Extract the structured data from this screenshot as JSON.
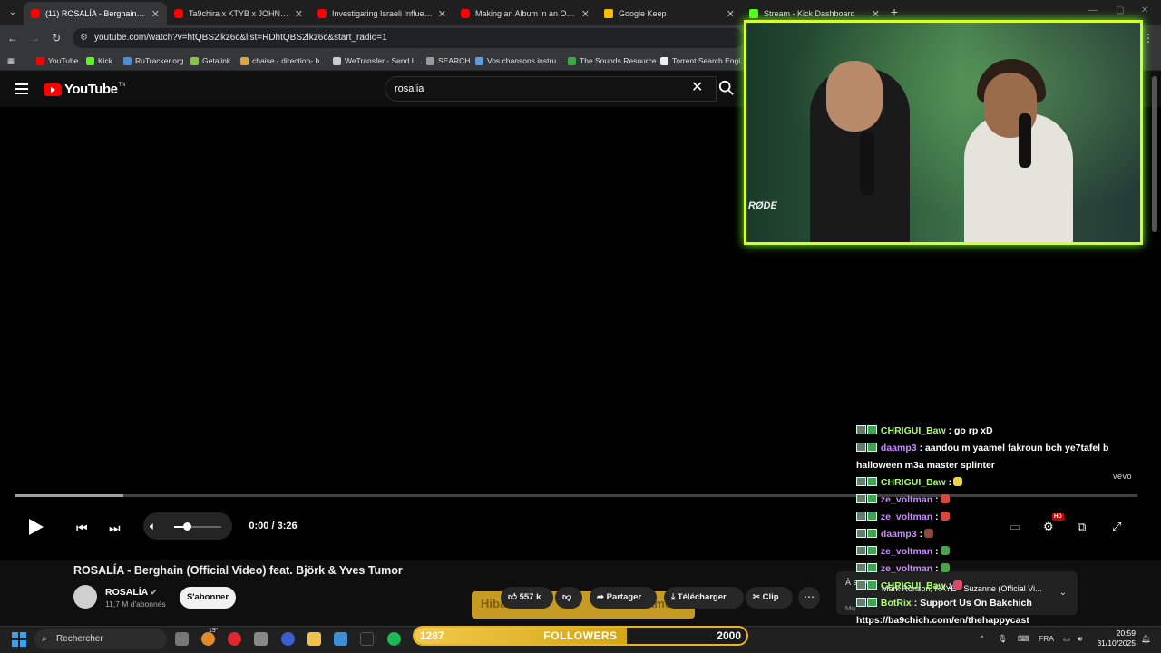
{
  "browser": {
    "tabs": [
      {
        "title": "(11) ROSALÍA - Berghain (Official",
        "icon": "youtube-icon",
        "active": true
      },
      {
        "title": "Ta9chira x KTYB x JOHNSIX - E",
        "icon": "youtube-icon",
        "active": false
      },
      {
        "title": "Investigating Israeli Influence o",
        "icon": "youtube-icon",
        "active": false
      },
      {
        "title": "Making an Album in an OPEN",
        "icon": "youtube-icon",
        "active": false
      },
      {
        "title": "Google Keep",
        "icon": "keep-icon",
        "active": false
      },
      {
        "title": "Stream - Kick Dashboard",
        "icon": "kick-icon",
        "active": false
      }
    ],
    "url": "youtube.com/watch?v=htQBS2lkz6c&list=RDhtQBS2lkz6c&start_radio=1",
    "bookmarks": [
      {
        "label": "YouTube",
        "color": "#ff0000"
      },
      {
        "label": "Kick",
        "color": "#53fc18"
      },
      {
        "label": "RuTracker.org",
        "color": "#4a90d9"
      },
      {
        "label": "Getalink",
        "color": "#8bc34a"
      },
      {
        "label": "chaise - direction- b...",
        "color": "#e2a73a"
      },
      {
        "label": "WeTransfer - Send L...",
        "color": "#cccccc"
      },
      {
        "label": "SEARCH",
        "color": "#999999"
      },
      {
        "label": "Vos chansons instru...",
        "color": "#5aa0e0"
      },
      {
        "label": "The Sounds Resource",
        "color": "#39a845"
      },
      {
        "label": "Torrent Search Engi...",
        "color": "#eeeeee"
      }
    ]
  },
  "youtube": {
    "logo_text": "YouTube",
    "logo_sup": "TN",
    "search_value": "rosalia",
    "player": {
      "time": "0:00 / 3:26",
      "vevo": "vevo",
      "hd_badge": "HD",
      "loaded_fraction": 0.097,
      "volume_fraction": 0.27
    },
    "video_title": "ROSALÍA - Berghain (Official Video) feat. Björk & Yves Tumor",
    "channel": {
      "name": "ROSALÍA",
      "subscribers": "11,7 M d'abonnés",
      "subscribe_label": "S'abonner"
    },
    "actions": {
      "likes": "557 k",
      "share": "Partager",
      "download": "Télécharger",
      "clip": "Clip"
    },
    "up_next": {
      "prefix": "À suivre",
      "title": "Mark Ronson, RAYE - Suzanne (Official Vi...",
      "sub": "Mix"
    }
  },
  "stream": {
    "cam_brand": "RØDE",
    "goal_overlay": {
      "left": "Hibarioz",
      "right": "69 Diamonds"
    },
    "chat": [
      {
        "user": "CHRIGUI_Baw",
        "text": ": go rp xD",
        "color": "green"
      },
      {
        "user": "daamp3",
        "text": ": aandou m yaamel fakroun bch ye7tafel b halloween m3a master splinter",
        "color": "violet"
      },
      {
        "user": "CHRIGUI_Baw",
        "text": ":",
        "color": "green",
        "emote": "#f0d24a"
      },
      {
        "user": "ze_voltman",
        "text": ":",
        "color": "violet",
        "emote": "#d9463a"
      },
      {
        "user": "ze_voltman",
        "text": ":",
        "color": "violet",
        "emote": "#d9463a"
      },
      {
        "user": "daamp3",
        "text": ":",
        "color": "violet",
        "emote": "#8b4a3a"
      },
      {
        "user": "ze_voltman",
        "text": ":",
        "color": "violet",
        "emote": "#4aa34a"
      },
      {
        "user": "ze_voltman",
        "text": ":",
        "color": "violet",
        "emote": "#4aa34a"
      },
      {
        "user": "CHRIGUI_Baw",
        "text": ":",
        "color": "green",
        "emote": "#d94a6a"
      },
      {
        "user": "BotRix",
        "text": ": Support Us On Bakchich https://ba9chich.com/en/thehappycast",
        "color": "green"
      },
      {
        "user": "ze_voltman",
        "text": ":",
        "color": "violet",
        "emote": "#4aa34a"
      }
    ],
    "followers": {
      "current": "1287",
      "label": "FOLLOWERS",
      "goal": "2000",
      "progress": 0.64
    }
  },
  "taskbar": {
    "search_label": "Rechercher",
    "weather": "19°",
    "lang": "FRA",
    "time": "20:59",
    "date": "31/10/2025"
  }
}
